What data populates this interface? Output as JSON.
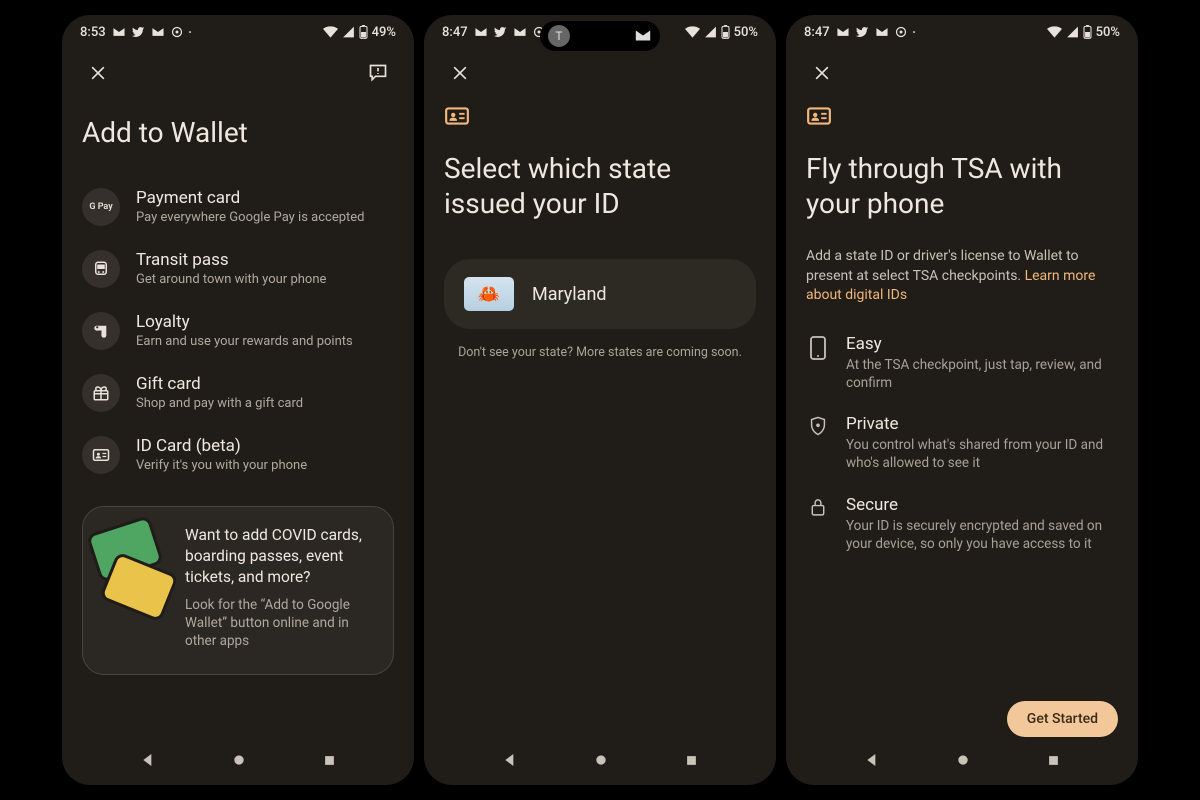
{
  "screens": [
    {
      "status": {
        "time": "8:53",
        "battery": "49%"
      },
      "title": "Add to Wallet",
      "items": [
        {
          "icon": "gpay",
          "title": "Payment card",
          "sub": "Pay everywhere Google Pay is accepted"
        },
        {
          "icon": "transit",
          "title": "Transit pass",
          "sub": "Get around town with your phone"
        },
        {
          "icon": "loyalty",
          "title": "Loyalty",
          "sub": "Earn and use your rewards and points"
        },
        {
          "icon": "gift",
          "title": "Gift card",
          "sub": "Shop and pay with a gift card"
        },
        {
          "icon": "idcard",
          "title": "ID Card (beta)",
          "sub": "Verify it's you with your phone"
        }
      ],
      "promo": {
        "title": "Want to add COVID cards, boarding passes, event tickets, and more?",
        "sub": "Look for the “Add to Google Wallet” button online and in other apps"
      }
    },
    {
      "status": {
        "time": "8:47",
        "battery": "50%"
      },
      "title": "Select which state issued your ID",
      "state": {
        "name": "Maryland",
        "emoji": "🦀"
      },
      "hint": "Don't see your state? More states are coming soon."
    },
    {
      "status": {
        "time": "8:47",
        "battery": "50%"
      },
      "title": "Fly through TSA with your phone",
      "body": "Add a state ID or driver's license to Wallet to present at select TSA checkpoints. ",
      "link": "Learn more about digital IDs",
      "features": [
        {
          "icon": "phone",
          "title": "Easy",
          "sub": "At the TSA checkpoint, just tap, review, and confirm"
        },
        {
          "icon": "shield",
          "title": "Private",
          "sub": "You control what's shared from your ID and who's allowed to see it"
        },
        {
          "icon": "lock",
          "title": "Secure",
          "sub": "Your ID is securely encrypted and saved on your device, so only you have access to it"
        }
      ],
      "cta": "Get Started"
    }
  ],
  "gpay_label": "G Pay"
}
